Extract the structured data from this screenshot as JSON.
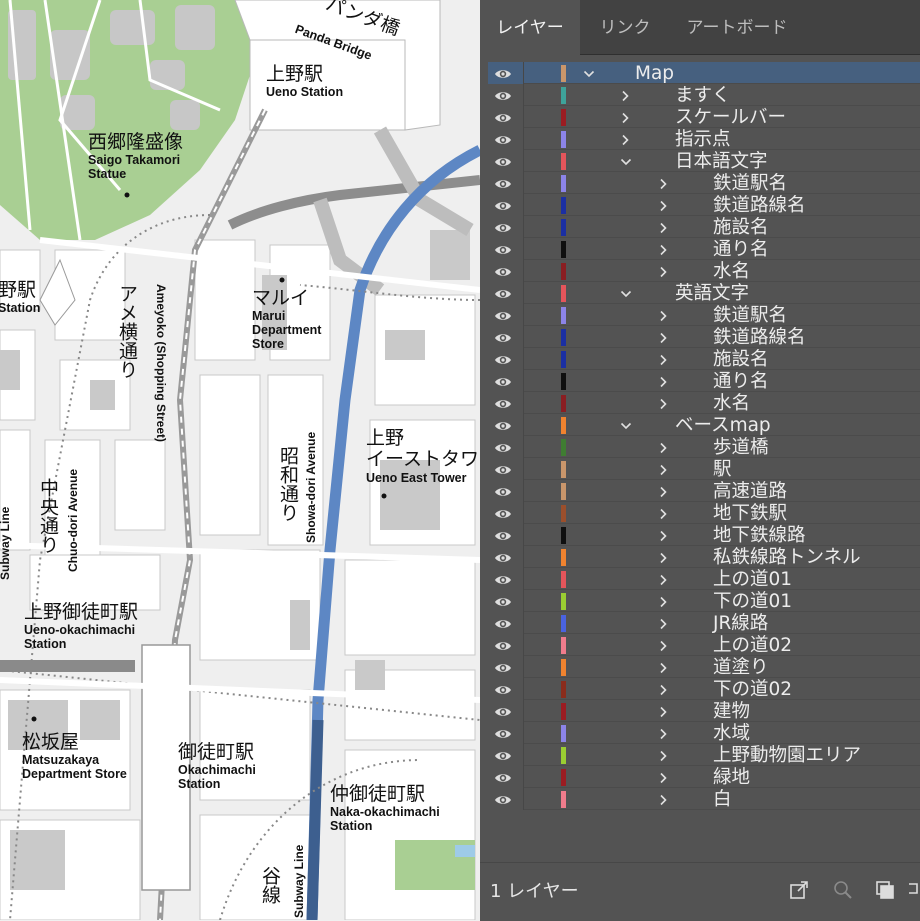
{
  "map": {
    "labels": {
      "panda_en": "Panda Bridge",
      "panda_ja": "パンダ橋",
      "ueno_ja": "上野駅",
      "ueno_en": "Ueno Station",
      "saigo_ja": "西郷隆盛像",
      "saigo_en1": "Saigo Takamori",
      "saigo_en2": "Statue",
      "left_station_ja": "野駅",
      "left_station_en": "Station",
      "ameyoko_ja": "アメ横通り",
      "ameyoko_en": "Ameyoko (Shopping Street)",
      "marui_ja": "マルイ",
      "marui_en1": "Marui",
      "marui_en2": "Department",
      "marui_en3": "Store",
      "showa_ja": "昭和通り",
      "showa_en": "Showa-dori Avenue",
      "eastower_ja1": "上野",
      "eastower_ja2": "イーストタワー",
      "eastower_en": "Ueno East Tower",
      "chuo_ja": "中央通り",
      "chuo_en": "Chuo-dori Avenue",
      "subway_left": "Subway Line",
      "okachi_ja": "上野御徒町駅",
      "okachi_en1": "Ueno-okachimachi",
      "okachi_en2": "Station",
      "matsu_ja": "松坂屋",
      "matsu_en1": "Matsuzakaya",
      "matsu_en2": "Department Store",
      "okachimachi_ja": "御徒町駅",
      "okachimachi_en1": "Okachimachi",
      "okachimachi_en2": "Station",
      "naka_ja": "仲御徒町駅",
      "naka_en1": "Naka-okachimachi",
      "naka_en2": "Station",
      "bottom_ja": "谷線",
      "bottom_en": "Subway Line"
    }
  },
  "panel": {
    "tabs": [
      {
        "label": "レイヤー",
        "active": true
      },
      {
        "label": "リンク",
        "active": false
      },
      {
        "label": "アートボード",
        "active": false
      }
    ],
    "layers": [
      {
        "name": "Map",
        "depth": 0,
        "expanded": true,
        "color": "#c9966b",
        "selected": true
      },
      {
        "name": "ますく",
        "depth": 1,
        "expanded": false,
        "color": "#3ea39a"
      },
      {
        "name": "スケールバー",
        "depth": 1,
        "expanded": false,
        "color": "#9b1c22"
      },
      {
        "name": "指示点",
        "depth": 1,
        "expanded": false,
        "color": "#8c84e8"
      },
      {
        "name": "日本語文字",
        "depth": 1,
        "expanded": true,
        "color": "#e4555b"
      },
      {
        "name": "鉄道駅名",
        "depth": 2,
        "expanded": false,
        "color": "#8c84e8"
      },
      {
        "name": "鉄道路線名",
        "depth": 2,
        "expanded": false,
        "color": "#1b2fa3"
      },
      {
        "name": "施設名",
        "depth": 2,
        "expanded": false,
        "color": "#1b2fa3"
      },
      {
        "name": "通り名",
        "depth": 2,
        "expanded": false,
        "color": "#0f0f0f"
      },
      {
        "name": "水名",
        "depth": 2,
        "expanded": false,
        "color": "#8a1e22"
      },
      {
        "name": "英語文字",
        "depth": 1,
        "expanded": true,
        "color": "#e4555b"
      },
      {
        "name": "鉄道駅名",
        "depth": 2,
        "expanded": false,
        "color": "#8c84e8"
      },
      {
        "name": "鉄道路線名",
        "depth": 2,
        "expanded": false,
        "color": "#1b2fa3"
      },
      {
        "name": "施設名",
        "depth": 2,
        "expanded": false,
        "color": "#1b2fa3"
      },
      {
        "name": "通り名",
        "depth": 2,
        "expanded": false,
        "color": "#0f0f0f"
      },
      {
        "name": "水名",
        "depth": 2,
        "expanded": false,
        "color": "#8a1e22"
      },
      {
        "name": "ベースmap",
        "depth": 1,
        "expanded": true,
        "color": "#f0832f"
      },
      {
        "name": "歩道橋",
        "depth": 2,
        "expanded": false,
        "color": "#3f7d32"
      },
      {
        "name": "駅",
        "depth": 2,
        "expanded": false,
        "color": "#c9966b"
      },
      {
        "name": "高速道路",
        "depth": 2,
        "expanded": false,
        "color": "#c9966b"
      },
      {
        "name": "地下鉄駅",
        "depth": 2,
        "expanded": false,
        "color": "#9b4f2c"
      },
      {
        "name": "地下鉄線路",
        "depth": 2,
        "expanded": false,
        "color": "#0f0f0f"
      },
      {
        "name": "私鉄線路トンネル",
        "depth": 2,
        "expanded": false,
        "color": "#f0832f"
      },
      {
        "name": "上の道01",
        "depth": 2,
        "expanded": false,
        "color": "#e4555b"
      },
      {
        "name": "下の道01",
        "depth": 2,
        "expanded": false,
        "color": "#9acd32"
      },
      {
        "name": "JR線路",
        "depth": 2,
        "expanded": false,
        "color": "#4a63e0"
      },
      {
        "name": "上の道02",
        "depth": 2,
        "expanded": false,
        "color": "#f07c8c"
      },
      {
        "name": "道塗り",
        "depth": 2,
        "expanded": false,
        "color": "#f0832f"
      },
      {
        "name": "下の道02",
        "depth": 2,
        "expanded": false,
        "color": "#8a2c1c"
      },
      {
        "name": "建物",
        "depth": 2,
        "expanded": false,
        "color": "#9b1c22"
      },
      {
        "name": "水域",
        "depth": 2,
        "expanded": false,
        "color": "#8c84e8"
      },
      {
        "name": "上野動物園エリア",
        "depth": 2,
        "expanded": false,
        "color": "#9acd32"
      },
      {
        "name": "緑地",
        "depth": 2,
        "expanded": false,
        "color": "#9b1c22"
      },
      {
        "name": "白",
        "depth": 2,
        "expanded": false,
        "color": "#f07c8c"
      }
    ],
    "footer": {
      "count": "1 レイヤー",
      "buttons": [
        "export-icon",
        "locate-icon",
        "collect-icon",
        "more-icon"
      ]
    }
  }
}
